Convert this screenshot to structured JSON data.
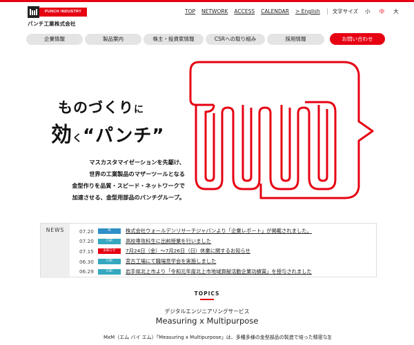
{
  "logo": {
    "en": "PUNCH INDUSTRY",
    "jp": "パンチ工業株式会社"
  },
  "util_nav": {
    "links": [
      "TOP",
      "NETWORK",
      "ACCESS",
      "CALENDAR",
      "> English"
    ],
    "font_size_label": "文字サイズ",
    "font_sizes": [
      "小",
      "中",
      "大"
    ],
    "font_size_active": "中"
  },
  "main_nav": {
    "items": [
      "企業情報",
      "製品案内",
      "株主・投資家情報",
      "CSRへの取り組み",
      "採用情報"
    ],
    "contact": "お問い合わせ"
  },
  "hero": {
    "line1_a": "ものづくり",
    "line1_b": "に",
    "line2_a": "効",
    "line2_b": "く",
    "line2_c": "“パンチ”",
    "lead": [
      "マスカスタマイゼーションを先駆け、",
      "世界の工業製品のマザーツールとなる",
      "金型作りを品質・スピード・ネットワークで",
      "加速させる、金型用部品のパンチグループ。"
    ]
  },
  "news": {
    "label": "NEWS",
    "items": [
      {
        "date": "07.20",
        "badge": "IR",
        "color": "#2f8fc7",
        "text": "株式会社ウォールデンリサーチジャパンより「企業レポート」が掲載されました。"
      },
      {
        "date": "07.20",
        "badge": "CSR",
        "color": "#35a8bf",
        "text": "高校専攻科生に出前授業を行いました"
      },
      {
        "date": "07.15",
        "badge": "お知らせ",
        "color": "#e60012",
        "text": "7月24日（金）～7月26日（日）休業に関するお知らせ"
      },
      {
        "date": "06.30",
        "badge": "CSR",
        "color": "#35a8bf",
        "text": "宮古工場にて職場見学会を実施しました"
      },
      {
        "date": "06.29",
        "badge": "CSR",
        "color": "#35a8bf",
        "text": "岩手県北上市より「令和元年度北上市地域貢献活動企業功績賞」を授与されました"
      }
    ]
  },
  "topics": {
    "heading": "TOPICS",
    "sub": "デジタルエンジニアリングサービス",
    "title": "Measuring x Multipurpose",
    "body": "MxM（エム バイ エム）「Measuring x Multipurpose」は、多種多様の金型部品の製造で培った精密な加工技術と品質管理を基盤とするデジタル測定サービスです。"
  },
  "colors": {
    "accent": "#e60012",
    "pill": "#e4e4e4",
    "news_bg": "#eeeeee"
  }
}
